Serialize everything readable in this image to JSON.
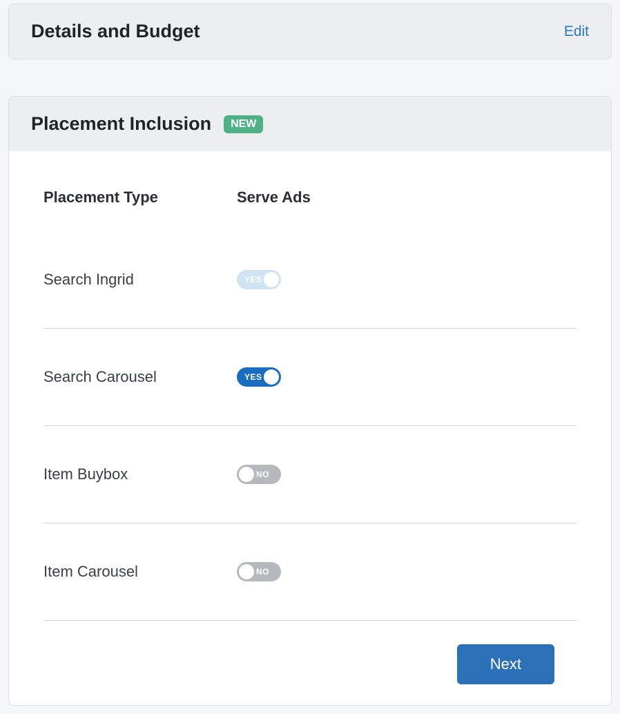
{
  "details": {
    "title": "Details and Budget",
    "edit_label": "Edit"
  },
  "placement": {
    "title": "Placement Inclusion",
    "badge": "NEW",
    "columns": {
      "type": "Placement Type",
      "serve": "Serve Ads"
    },
    "toggle_labels": {
      "on": "YES",
      "off": "NO"
    },
    "rows": [
      {
        "label": "Search Ingrid",
        "state": "on",
        "disabled": true
      },
      {
        "label": "Search Carousel",
        "state": "on",
        "disabled": false
      },
      {
        "label": "Item Buybox",
        "state": "off",
        "disabled": false
      },
      {
        "label": "Item Carousel",
        "state": "off",
        "disabled": false
      }
    ],
    "next_label": "Next"
  }
}
